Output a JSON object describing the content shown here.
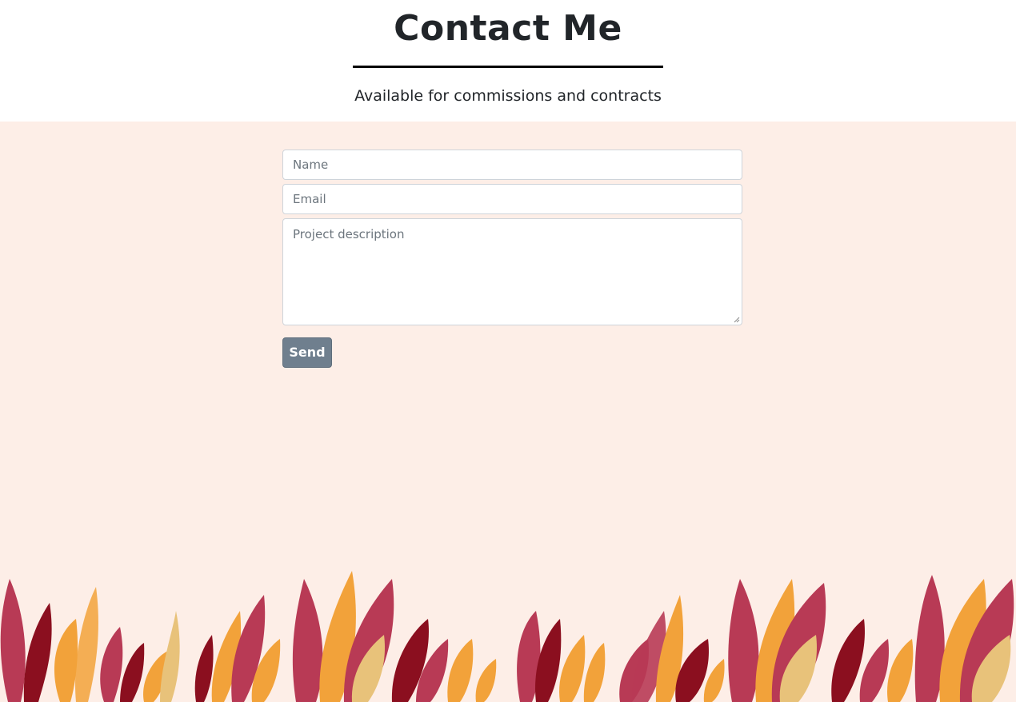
{
  "header": {
    "title": "Contact Me",
    "subtitle": "Available for commissions and contracts"
  },
  "form": {
    "name_placeholder": "Name",
    "email_placeholder": "Email",
    "description_placeholder": "Project description",
    "send_label": "Send"
  },
  "colors": {
    "background": "#fdeee7",
    "button": "#6f7f8e",
    "leaf_maroon": "#8b0f1f",
    "leaf_rose": "#b83a55",
    "leaf_orange": "#f2a23a",
    "leaf_sand": "#e8c27a"
  },
  "decoration": {
    "footer_art": "autumn-leaves-illustration"
  }
}
